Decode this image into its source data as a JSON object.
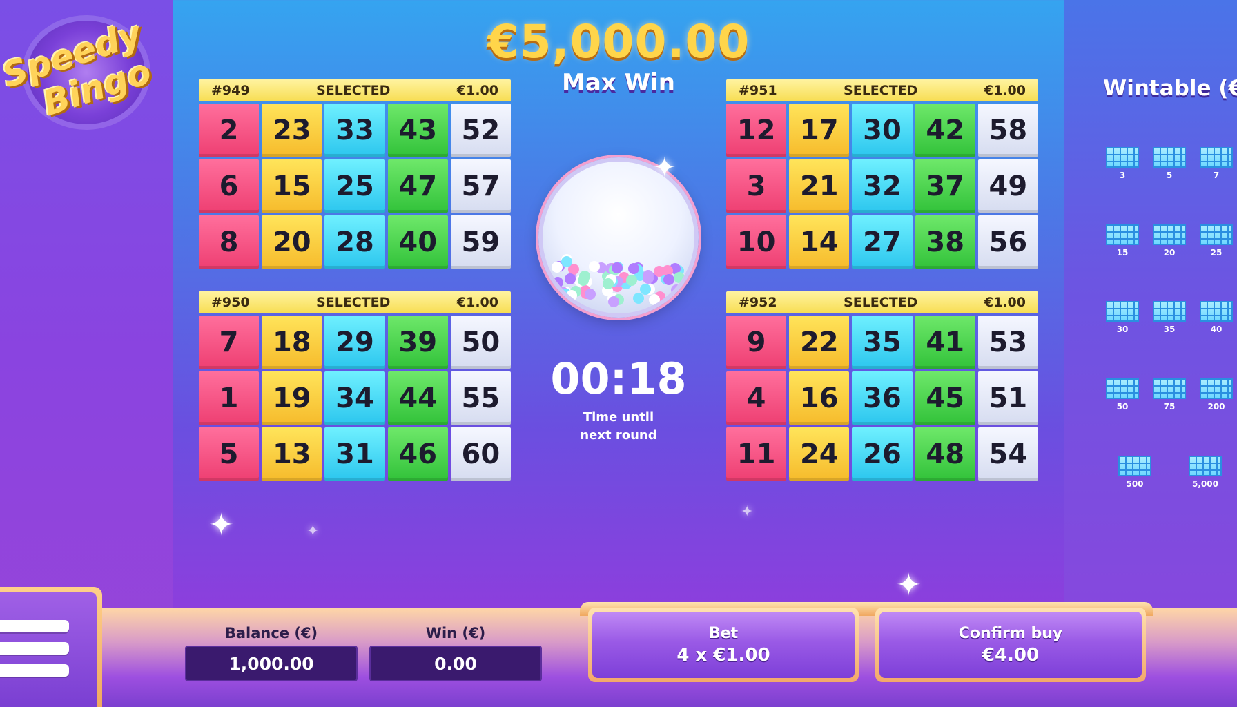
{
  "game": {
    "logo_line1": "Speedy",
    "logo_line2": "Bingo"
  },
  "max_win": {
    "amount": "€5,000.00",
    "label": "Max Win"
  },
  "cards": [
    {
      "id": "#949",
      "status": "SELECTED",
      "price": "€1.00",
      "rows": [
        [
          2,
          23,
          33,
          43,
          52
        ],
        [
          6,
          15,
          25,
          47,
          57
        ],
        [
          8,
          20,
          28,
          40,
          59
        ]
      ]
    },
    {
      "id": "#950",
      "status": "SELECTED",
      "price": "€1.00",
      "rows": [
        [
          7,
          18,
          29,
          39,
          50
        ],
        [
          1,
          19,
          34,
          44,
          55
        ],
        [
          5,
          13,
          31,
          46,
          60
        ]
      ]
    },
    {
      "id": "#951",
      "status": "SELECTED",
      "price": "€1.00",
      "rows": [
        [
          12,
          17,
          30,
          42,
          58
        ],
        [
          3,
          21,
          32,
          37,
          49
        ],
        [
          10,
          14,
          27,
          38,
          56
        ]
      ]
    },
    {
      "id": "#952",
      "status": "SELECTED",
      "price": "€1.00",
      "rows": [
        [
          9,
          22,
          35,
          41,
          53
        ],
        [
          4,
          16,
          36,
          45,
          51
        ],
        [
          11,
          24,
          26,
          48,
          54
        ]
      ]
    }
  ],
  "timer": {
    "value": "00:18",
    "label_line1": "Time until",
    "label_line2": "next round"
  },
  "wintable": {
    "title": "Wintable (€)",
    "items": [
      "3",
      "5",
      "7",
      "15",
      "20",
      "25",
      "30",
      "35",
      "40",
      "50",
      "75",
      "200",
      "500",
      "5,000"
    ]
  },
  "balance": {
    "label": "Balance (€)",
    "value": "1,000.00"
  },
  "win": {
    "label": "Win (€)",
    "value": "0.00"
  },
  "bet_button": {
    "label": "Bet",
    "value": "4 x €1.00"
  },
  "confirm_button": {
    "label": "Confirm buy",
    "value": "€4.00"
  },
  "colors": {
    "pink": "#ee3f72",
    "yellow": "#f6bb2c",
    "cyan": "#2cc6ee",
    "green": "#32c23a",
    "white": "#d6dcf0",
    "gold": "#ffd54a"
  }
}
